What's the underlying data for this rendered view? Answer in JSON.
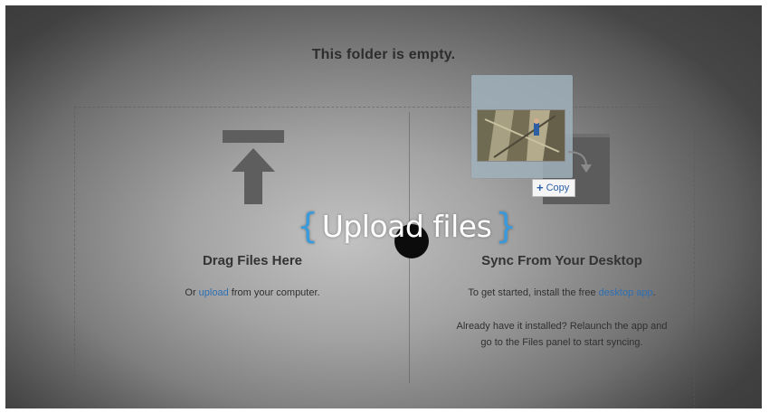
{
  "empty_state": {
    "title": "This folder is empty."
  },
  "overlay": {
    "brace_left": "{",
    "label": "Upload files",
    "brace_right": "}",
    "brace_color": "#3a9bdc"
  },
  "upload_column": {
    "heading": "Drag Files Here",
    "sub_prefix": "Or ",
    "sub_link": "upload",
    "sub_suffix": " from your computer.",
    "icon": "upload-arrow-icon"
  },
  "sync_column": {
    "heading": "Sync From Your Desktop",
    "sub_prefix": "To get started, install the free ",
    "sub_link": "desktop app",
    "sub_suffix": ".",
    "note_line1": "Already have it installed? Relaunch the app and",
    "note_line2": "go to the Files panel to start syncing.",
    "copy_badge": "Copy",
    "copy_icon": "plus-icon"
  },
  "colors": {
    "link": "#2d6fb4",
    "accent_brace": "#3a9bdc"
  }
}
